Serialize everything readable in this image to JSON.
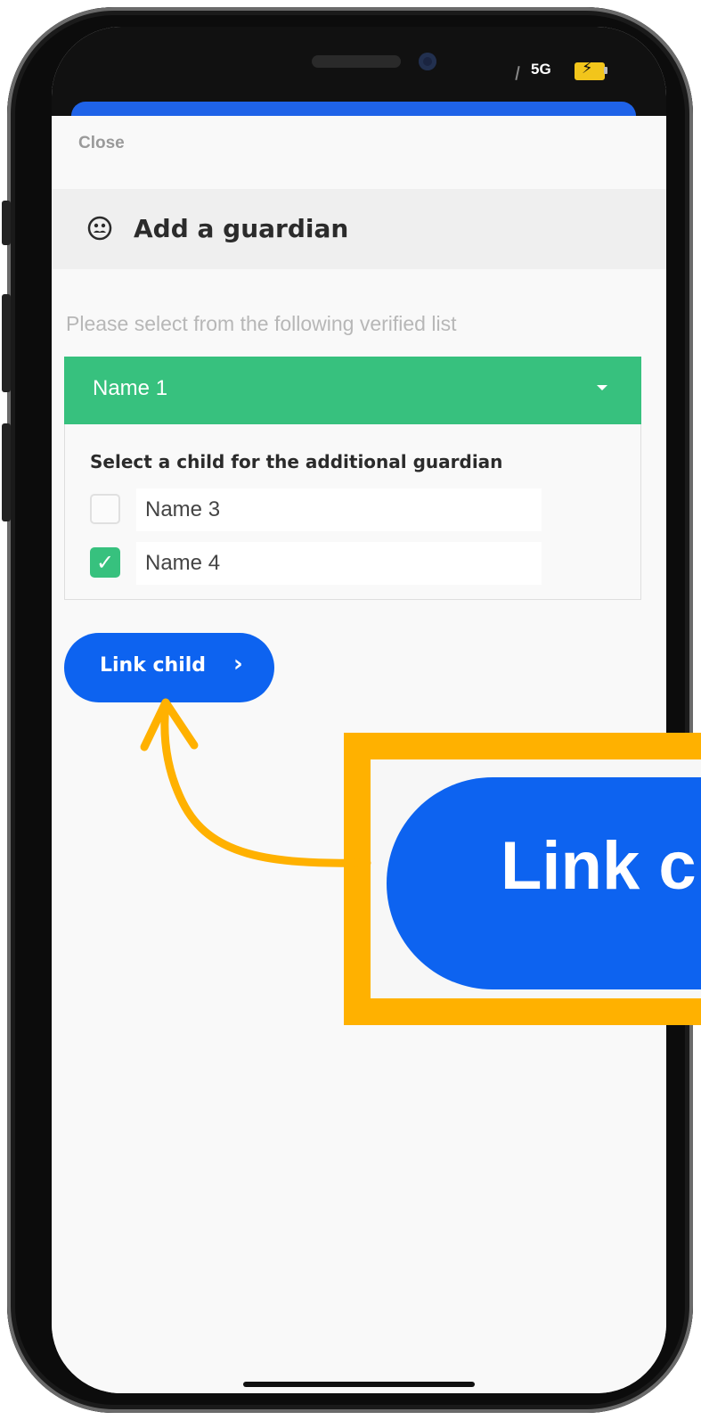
{
  "status_bar": {
    "network": "5G",
    "battery_color": "#f2c51b"
  },
  "sheet": {
    "close_label": "Close",
    "title": "Add a guardian",
    "title_icon": "guardian-face-icon",
    "instruction": "Please select from the following verified list"
  },
  "guardian_select": {
    "selected": "Name 1",
    "color": "#37c17e"
  },
  "children": {
    "heading": "Select a child for the additional guardian",
    "items": [
      {
        "label": "Name 3",
        "checked": false
      },
      {
        "label": "Name 4",
        "checked": true
      }
    ]
  },
  "actions": {
    "link_child_label": "Link child",
    "link_child_icon": "chevron-right-icon",
    "button_color": "#0d63f0"
  },
  "callout": {
    "zoom_label": "Link c",
    "highlight_color": "#ffb100"
  }
}
